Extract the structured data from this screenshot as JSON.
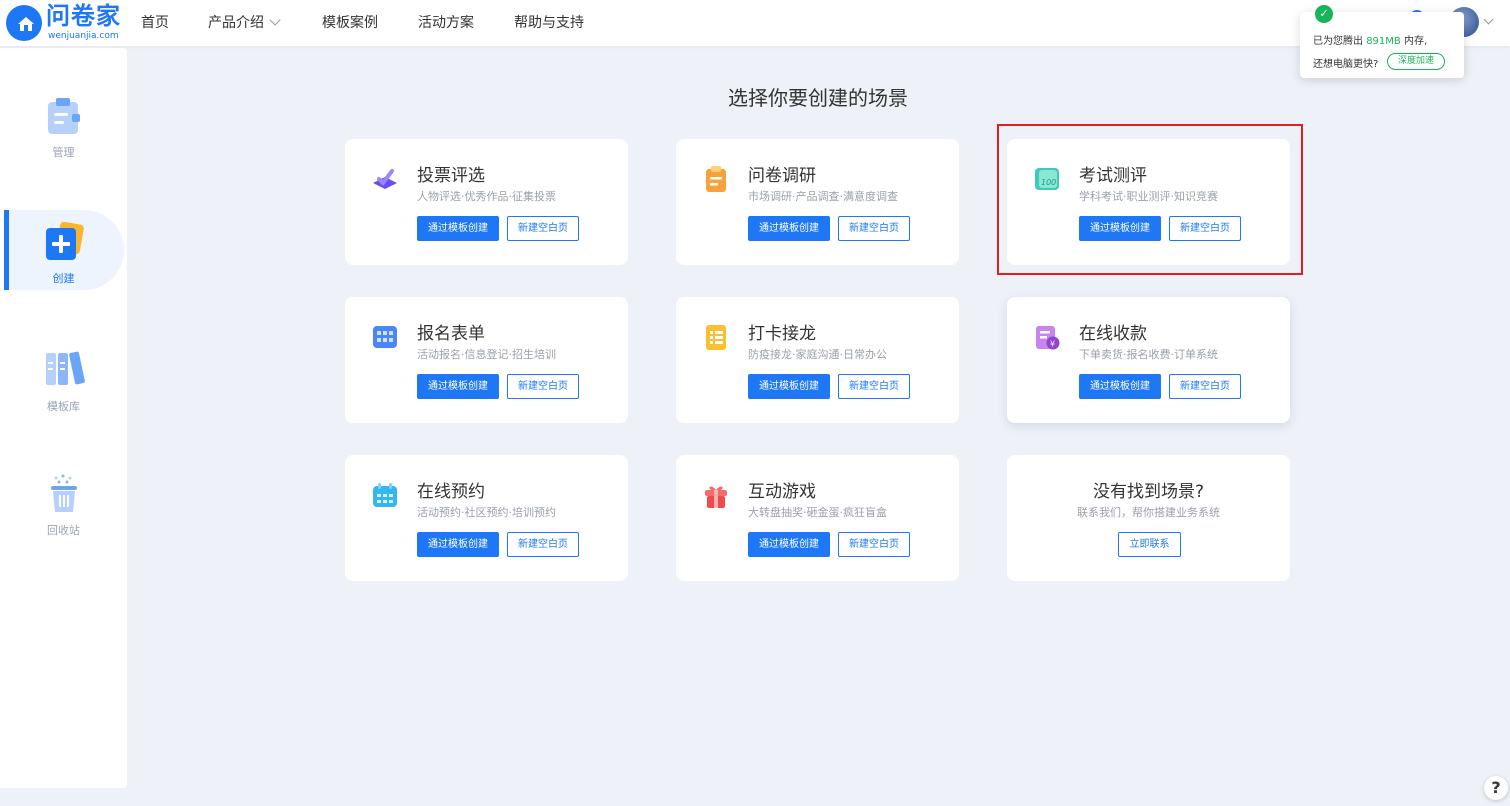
{
  "brand": {
    "name": "问卷家",
    "domain": "wenjuanjia.com",
    "color": "#1e78f5"
  },
  "nav": {
    "items": [
      "首页",
      "产品介绍",
      "模板案例",
      "活动方案",
      "帮助与支持"
    ]
  },
  "popup": {
    "line1_prefix": "已为您腾出",
    "line1_value": "891MB",
    "line1_suffix": "内存,",
    "line2": "还想电脑更快?",
    "button": "深度加速"
  },
  "sidebar": {
    "items": [
      {
        "label": "管理",
        "icon": "clipboard-icon"
      },
      {
        "label": "创建",
        "icon": "plus-icon",
        "active": true
      },
      {
        "label": "模板库",
        "icon": "books-icon"
      },
      {
        "label": "回收站",
        "icon": "trash-icon"
      }
    ]
  },
  "main": {
    "title": "选择你要创建的场景",
    "primary_label": "通过模板创建",
    "outline_label": "新建空白页",
    "cards": [
      {
        "title": "投票评选",
        "desc": "人物评选·优秀作品·征集投票",
        "icon": "vote-icon"
      },
      {
        "title": "问卷调研",
        "desc": "市场调研·产品调查·满意度调查",
        "icon": "survey-icon"
      },
      {
        "title": "考试测评",
        "desc": "学科考试·职业测评·知识竞赛",
        "icon": "exam-icon"
      },
      {
        "title": "报名表单",
        "desc": "活动报名·信息登记·招生培训",
        "icon": "form-icon"
      },
      {
        "title": "打卡接龙",
        "desc": "防疫接龙·家庭沟通·日常办公",
        "icon": "checkin-icon"
      },
      {
        "title": "在线收款",
        "desc": "下单卖货·报名收费·订单系统",
        "icon": "payment-icon"
      },
      {
        "title": "在线预约",
        "desc": "活动预约·社区预约·培训预约",
        "icon": "calendar-icon"
      },
      {
        "title": "互动游戏",
        "desc": "大转盘抽奖·砸金蛋·疯狂盲盒",
        "icon": "gift-icon"
      }
    ],
    "contact_card": {
      "title": "没有找到场景?",
      "desc": "联系我们，帮你搭建业务系统",
      "button": "立即联系"
    }
  },
  "help_button": "?"
}
